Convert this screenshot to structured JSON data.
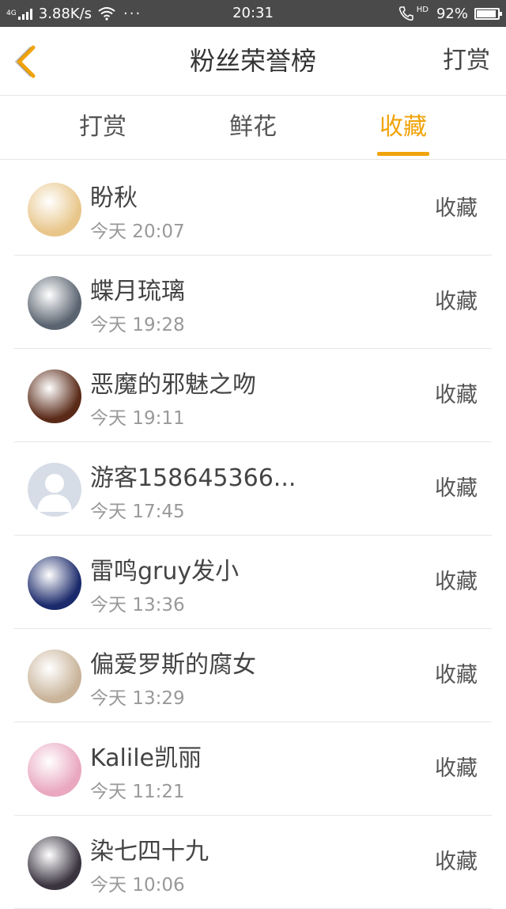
{
  "status_bar": {
    "network": "4G",
    "speed": "3.88K/s",
    "dots": "···",
    "time": "20:31",
    "hd": "HD",
    "battery": "92%",
    "battery_level": 0.92
  },
  "navbar": {
    "back_icon": "chevron-left-icon",
    "title": "粉丝荣誉榜",
    "right_label": "打赏",
    "accent": "#f0a30a"
  },
  "tabs": [
    {
      "label": "打赏",
      "active": false
    },
    {
      "label": "鲜花",
      "active": false
    },
    {
      "label": "收藏",
      "active": true
    }
  ],
  "list": [
    {
      "name": "盼秋",
      "time": "今天 20:07",
      "action": "收藏",
      "avatar_color": "#e8c68a"
    },
    {
      "name": "蝶月琉璃",
      "time": "今天 19:28",
      "action": "收藏",
      "avatar_color": "#5a6470"
    },
    {
      "name": "恶魔的邪魅之吻",
      "time": "今天 19:11",
      "action": "收藏",
      "avatar_color": "#5a2a18"
    },
    {
      "name": "游客158645366...",
      "time": "今天 17:45",
      "action": "收藏",
      "avatar_color": "#d7dde6"
    },
    {
      "name": "雷鸣gruy发小",
      "time": "今天 13:36",
      "action": "收藏",
      "avatar_color": "#1b2a6b"
    },
    {
      "name": "偏爱罗斯的腐女",
      "time": "今天 13:29",
      "action": "收藏",
      "avatar_color": "#c9b49a"
    },
    {
      "name": "Kalile凯丽",
      "time": "今天 11:21",
      "action": "收藏",
      "avatar_color": "#e9a7c0"
    },
    {
      "name": "染七四十九",
      "time": "今天 10:06",
      "action": "收藏",
      "avatar_color": "#3a3440"
    }
  ]
}
